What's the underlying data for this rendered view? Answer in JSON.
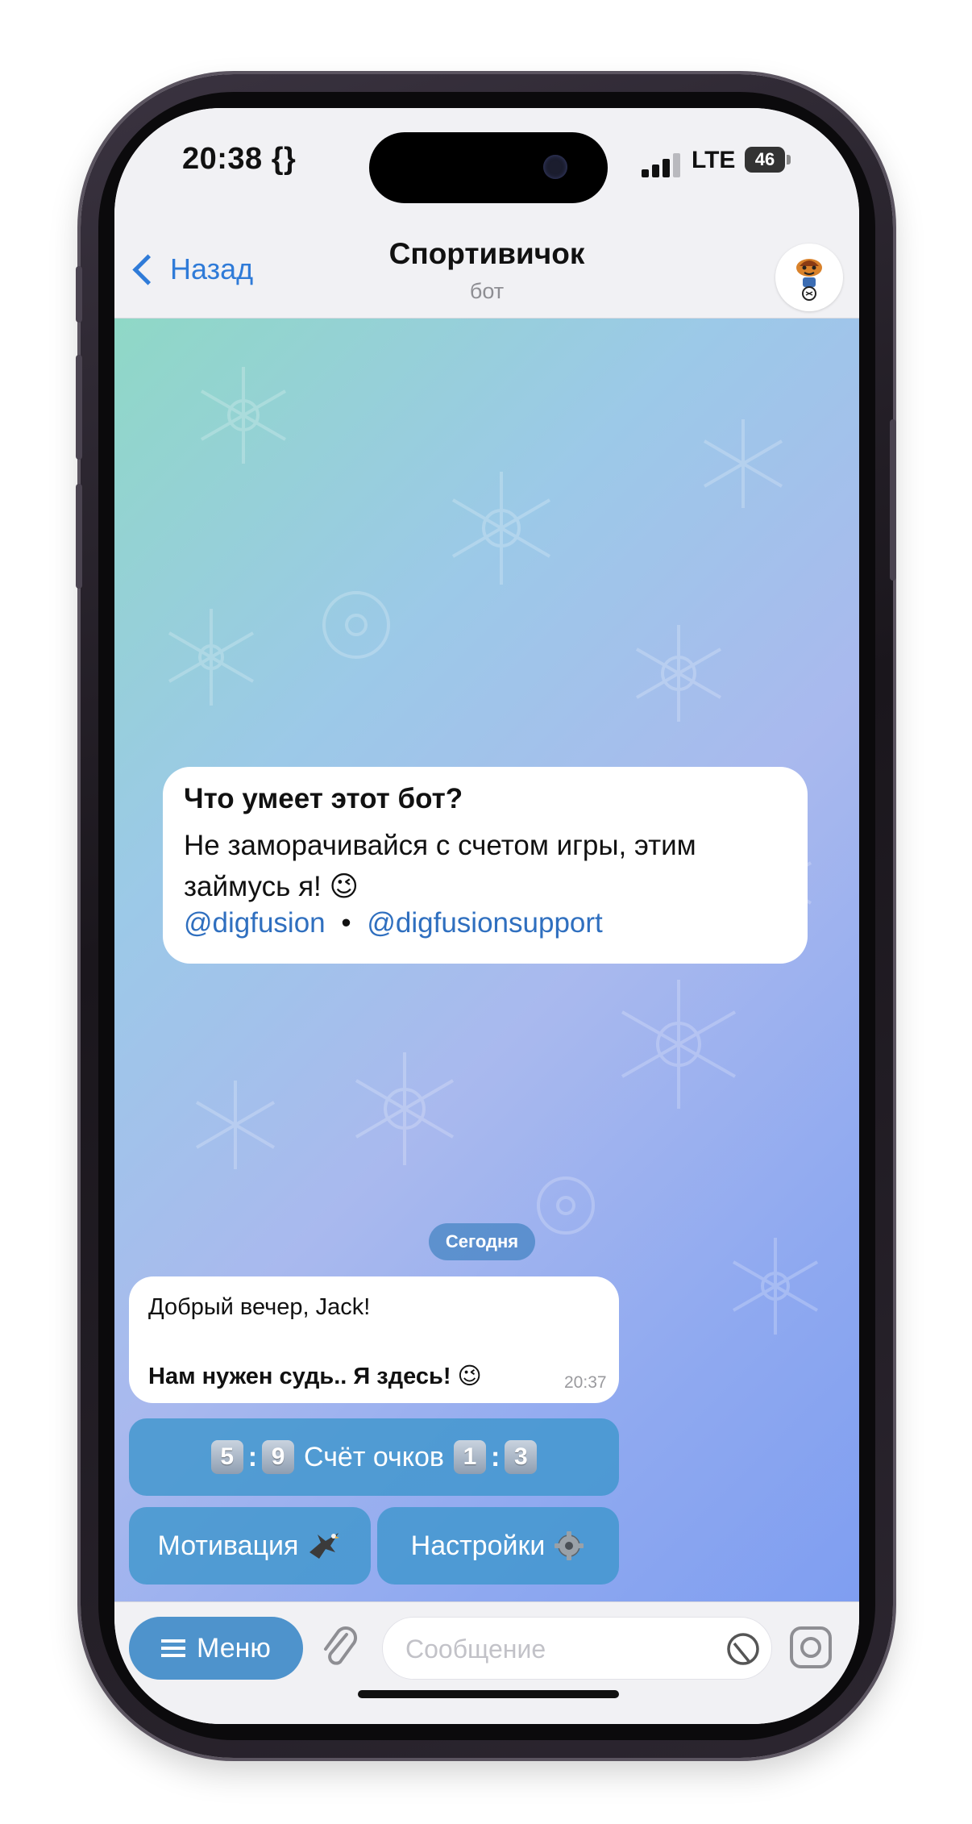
{
  "status_bar": {
    "time": "20:38 {}",
    "network": "LTE",
    "battery": "46"
  },
  "header": {
    "back_label": "Назад",
    "title": "Спортивичок",
    "subtitle": "бот",
    "avatar_icon": "bot-avatar-icon"
  },
  "intro": {
    "title": "Что умеет этот бот?",
    "text": "Не заморачивайся с счетом игры, этим займусь я! 😉",
    "links": [
      "@digfusion",
      "@digfusionsupport"
    ],
    "link_separator": "•"
  },
  "chat": {
    "date_chip": "Сегодня",
    "message": {
      "line1": "Добрый вечер, Jack!",
      "line2": "Нам нужен судь.. Я здесь! 😉",
      "time": "20:37"
    }
  },
  "keyboard": {
    "score_button": {
      "left_a": "5",
      "left_b": "9",
      "label": "Счёт очков",
      "right_a": "1",
      "right_b": "3",
      "separator": ":"
    },
    "motivation_button": {
      "label": "Мотивация",
      "icon": "eagle-icon"
    },
    "settings_button": {
      "label": "Настройки",
      "icon": "gear-icon"
    }
  },
  "input_bar": {
    "menu_label": "Меню",
    "placeholder": "Сообщение"
  },
  "colors": {
    "accent": "#2f7bd8",
    "bot_button": "#4096cd",
    "menu_button": "#4e93cc"
  }
}
